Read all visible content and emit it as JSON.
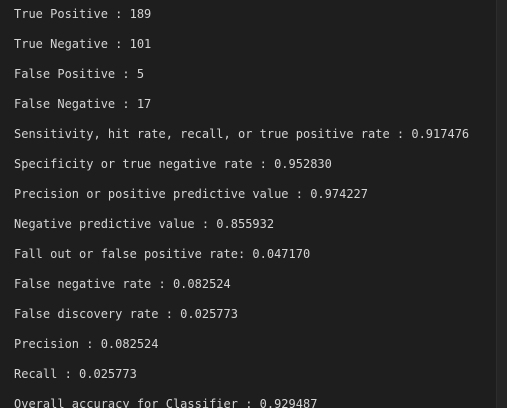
{
  "terminal": {
    "lines": [
      "True Positive : 189",
      "True Negative : 101",
      "False Positive : 5",
      "False Negative : 17",
      "Sensitivity, hit rate, recall, or true positive rate : 0.917476",
      "Specificity or true negative rate : 0.952830",
      "Precision or positive predictive value : 0.974227",
      "Negative predictive value : 0.855932",
      "Fall out or false positive rate: 0.047170",
      "False negative rate : 0.082524",
      "False discovery rate : 0.025773",
      "Precision : 0.082524",
      "Recall : 0.025773",
      "Overall accuracy for Classifier : 0.929487"
    ]
  },
  "colors": {
    "background": "#1e1e1e",
    "text": "#d4d4d4"
  }
}
